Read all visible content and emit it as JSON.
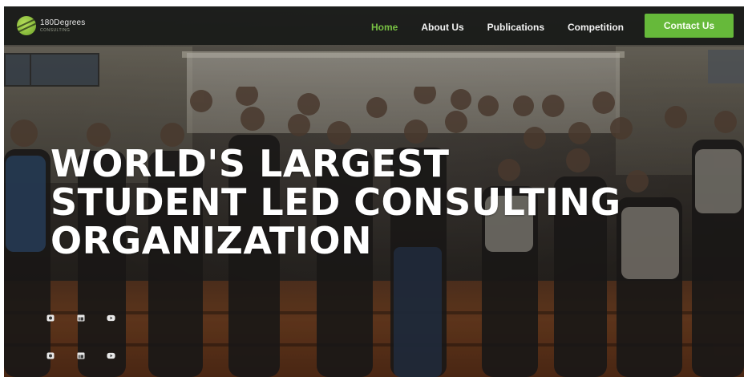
{
  "nav": {
    "logo_title": "180Degrees",
    "logo_sub": "CONSULTING",
    "links": [
      {
        "label": "Home",
        "active": true
      },
      {
        "label": "About Us",
        "active": false
      },
      {
        "label": "Publications",
        "active": false
      },
      {
        "label": "Competition",
        "active": false
      }
    ],
    "cta_label": "Contact Us"
  },
  "hero": {
    "lines": [
      "WORLD'S LARGEST",
      "STUDENT LED CONSULTING",
      "ORGANIZATION"
    ]
  },
  "social": {
    "rows": [
      [
        "instagram-icon",
        "linkedin-icon",
        "youtube-icon"
      ],
      [
        "instagram-icon",
        "linkedin-icon",
        "youtube-icon"
      ]
    ]
  },
  "colors": {
    "accent": "#66b93a",
    "active_link": "#78c043",
    "nav_bg": "#181a18"
  }
}
